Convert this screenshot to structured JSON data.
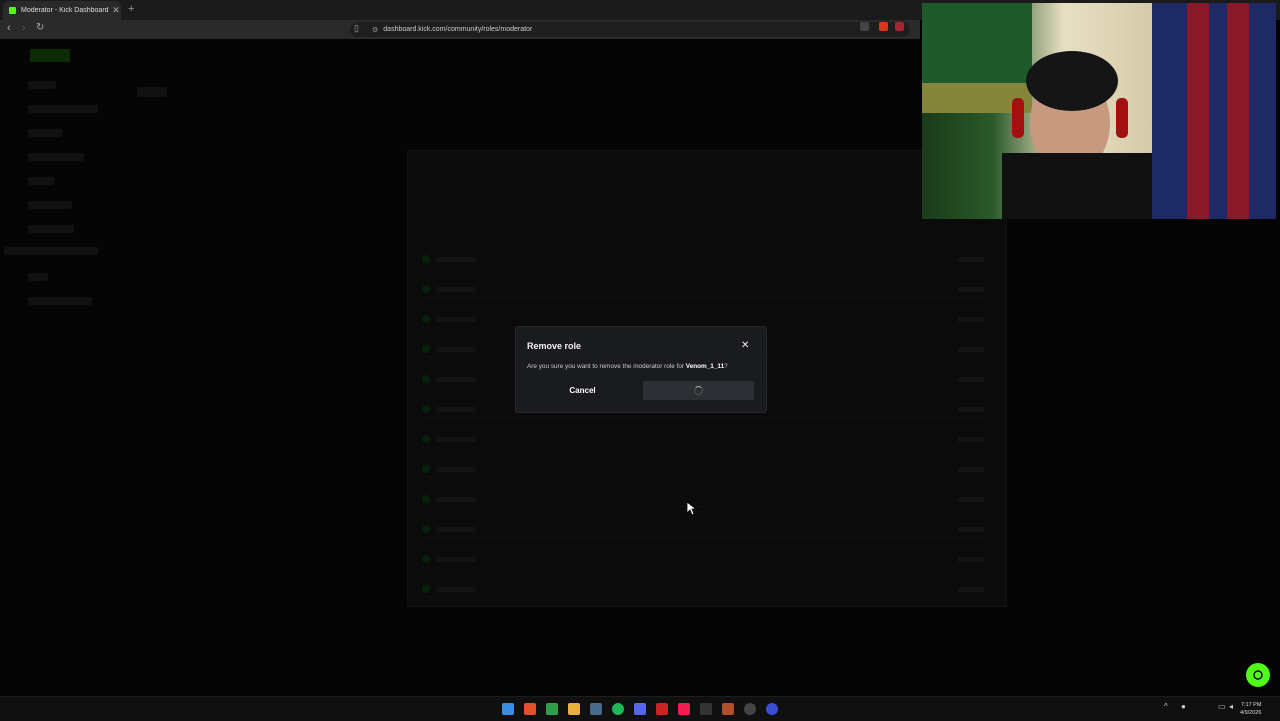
{
  "browser": {
    "tab_title": "Moderator - Kick Dashboard",
    "tab_close": "✕",
    "new_tab": "+",
    "url": "dashboard.kick.com/community/roles/moderator"
  },
  "modal": {
    "title": "Remove role",
    "close": "✕",
    "message_prefix": "Are you sure you want to remove the moderator role for ",
    "username": "Venom_1_11",
    "message_suffix": "?",
    "cancel_label": "Cancel",
    "confirm_state": "loading"
  },
  "taskbar": {
    "time": "7:17 PM",
    "date": "4/9/2026"
  },
  "colors": {
    "accent": "#53fc18",
    "modal_bg": "#191b1f"
  }
}
